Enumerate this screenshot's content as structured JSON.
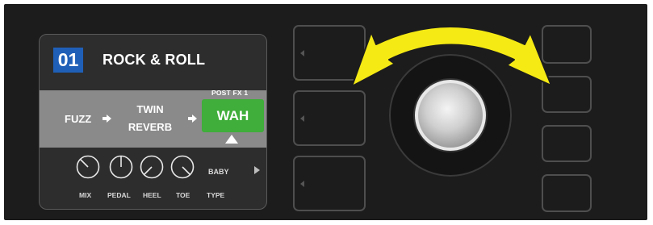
{
  "screen": {
    "preset_number": "01",
    "preset_name": "ROCK & ROLL",
    "slot_label": "POST FX 1",
    "chain": [
      {
        "line1": "FUZZ"
      },
      {
        "line1": "TWIN",
        "line2": "REVERB"
      },
      {
        "line1": "WAH",
        "selected": true
      }
    ],
    "params": [
      "MIX",
      "PEDAL",
      "HEEL",
      "TOE"
    ],
    "type_value": "BABY",
    "type_label": "TYPE"
  },
  "colors": {
    "preset_badge": "#1f5fb8",
    "selected_effect": "#3fae3a",
    "rotate_arrow": "#f5ea14"
  },
  "icons": {
    "rotate": "double-headed-curved-arrow-icon",
    "next_page": "triangle-right-icon"
  }
}
